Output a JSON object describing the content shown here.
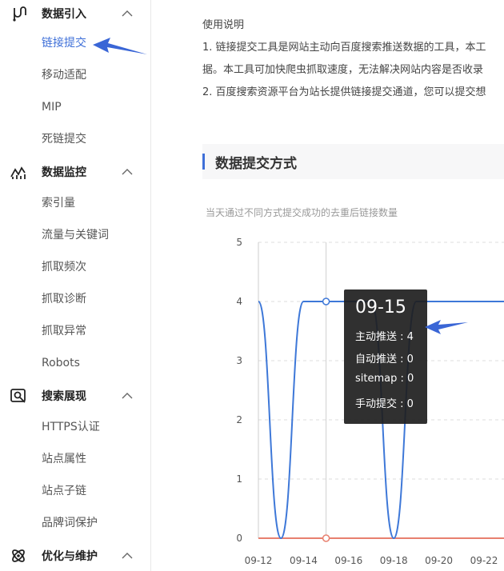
{
  "sidebar": {
    "groups": [
      {
        "title": "数据引入",
        "icon": "data-import-icon",
        "items": [
          "链接提交",
          "移动适配",
          "MIP",
          "死链提交"
        ]
      },
      {
        "title": "数据监控",
        "icon": "data-monitor-icon",
        "items": [
          "索引量",
          "流量与关键词",
          "抓取频次",
          "抓取诊断",
          "抓取异常",
          "Robots"
        ]
      },
      {
        "title": "搜索展现",
        "icon": "search-display-icon",
        "items": [
          "HTTPS认证",
          "站点属性",
          "站点子链",
          "品牌词保护"
        ]
      },
      {
        "title": "优化与维护",
        "icon": "optimize-maintain-icon",
        "items": []
      }
    ],
    "active_item": "链接提交"
  },
  "intro": {
    "heading": "使用说明",
    "line1": "1. 链接提交工具是网站主动向百度搜索推送数据的工具，本工",
    "line2": "据。本工具可加快爬虫抓取速度，无法解决网站内容是否收录",
    "line3": "2. 百度搜索资源平台为站长提供链接提交通道，您可以提交想"
  },
  "section": {
    "title": "数据提交方式"
  },
  "chart_caption": "当天通过不同方式提交成功的去重后链接数量",
  "tooltip": {
    "date": "09-15",
    "rows": [
      "主动推送 : 4",
      "自动推送 : 0",
      "sitemap : 0",
      "手动提交 : 0"
    ]
  },
  "colors": {
    "accent": "#3e6fd8",
    "series_active": "#3e78d8",
    "series_other": "#e8806f",
    "arrow": "#3a66d6"
  },
  "chart_data": {
    "type": "line",
    "x": [
      "09-12",
      "09-13",
      "09-14",
      "09-15",
      "09-16",
      "09-17",
      "09-18",
      "09-19",
      "09-20",
      "09-21",
      "09-22",
      "09-23"
    ],
    "x_ticks": [
      "09-12",
      "09-14",
      "09-16",
      "09-18",
      "09-20",
      "09-22"
    ],
    "ylim": [
      0,
      5
    ],
    "y_ticks": [
      0,
      1,
      2,
      3,
      4,
      5
    ],
    "grid": true,
    "series": [
      {
        "name": "主动推送",
        "values": [
          4,
          0,
          4,
          4,
          4,
          4,
          0,
          4,
          4,
          4,
          4,
          4
        ]
      },
      {
        "name": "自动推送",
        "values": [
          0,
          0,
          0,
          0,
          0,
          0,
          0,
          0,
          0,
          0,
          0,
          0
        ]
      }
    ],
    "highlight_x": "09-15"
  }
}
